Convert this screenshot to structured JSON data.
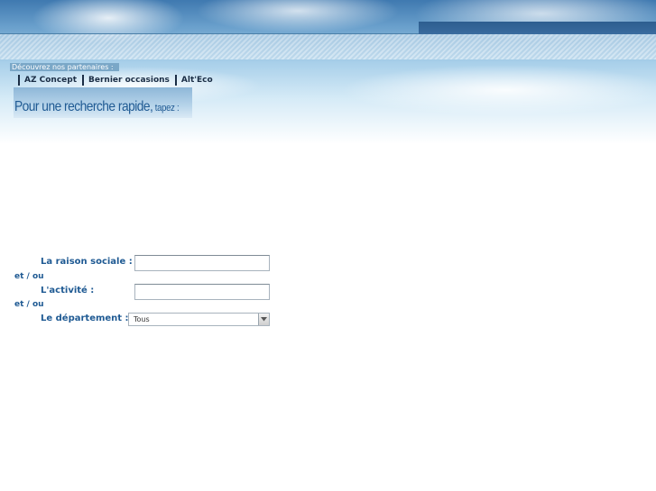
{
  "partners": {
    "title": "Découvrez nos partenaires :",
    "links": [
      "AZ Concept",
      "Bernier occasions",
      "Alt'Eco"
    ]
  },
  "search_banner": {
    "main": "Pour une recherche rapide,",
    "tail": " tapez :"
  },
  "form": {
    "raison_sociale_label": "La raison sociale :",
    "raison_sociale_value": "",
    "connector_1": "et / ou",
    "activite_label": "L'activité :",
    "activite_value": "",
    "connector_2": "et / ou",
    "departement_label": "Le département :",
    "departement_selected": "Tous"
  },
  "colors": {
    "label": "#1f5a93",
    "partner_text": "#1a2d45",
    "header_tab": "#2d5d8f"
  },
  "icons": {
    "select_arrow": "chevron-down-icon"
  }
}
